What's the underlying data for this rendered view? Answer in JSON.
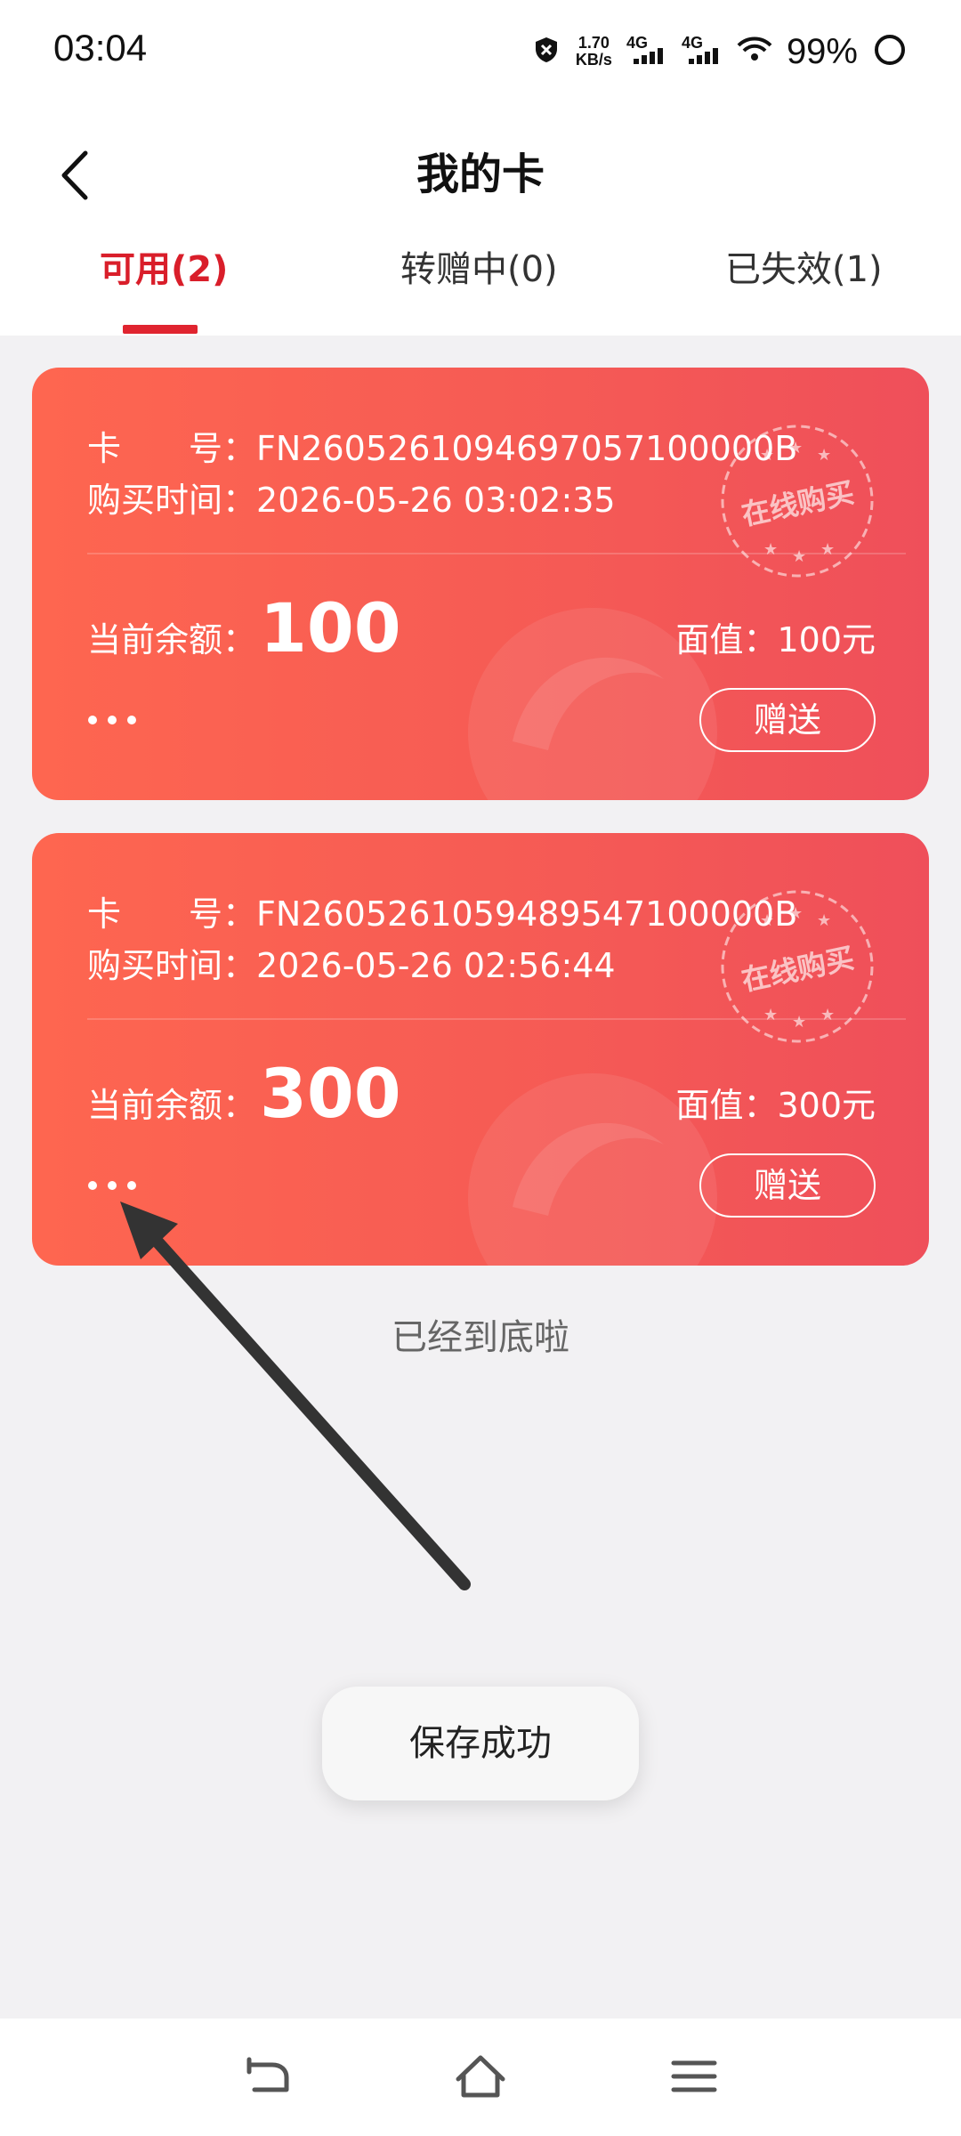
{
  "status_bar": {
    "time": "03:04",
    "net_speed_value": "1.70",
    "net_speed_unit": "KB/s",
    "sim1": "4G",
    "sim2": "4G",
    "battery": "99%"
  },
  "header": {
    "title": "我的卡"
  },
  "tabs": [
    {
      "label": "可用(2)",
      "active": true
    },
    {
      "label": "转赠中(0)",
      "active": false
    },
    {
      "label": "已失效(1)",
      "active": false
    }
  ],
  "cards": [
    {
      "card_no_label_a": "卡",
      "card_no_label_b": "号：",
      "card_no": "FN2605261094697057100000B",
      "purchase_label": "购买时间：",
      "purchase_time": "2026-05-26 03:02:35",
      "balance_label": "当前余额：",
      "balance": "100",
      "face_value": "面值：100元",
      "stamp_text": "在线购买",
      "gift_label": "赠送"
    },
    {
      "card_no_label_a": "卡",
      "card_no_label_b": "号：",
      "card_no": "FN2605261059489547100000B",
      "purchase_label": "购买时间：",
      "purchase_time": "2026-05-26 02:56:44",
      "balance_label": "当前余额：",
      "balance": "300",
      "face_value": "面值：300元",
      "stamp_text": "在线购买",
      "gift_label": "赠送"
    }
  ],
  "list_end_text": "已经到底啦",
  "toast": "保存成功",
  "colors": {
    "accent": "#e0242f",
    "card_start": "#fe6650",
    "card_end": "#ef4f5a",
    "background": "#f2f1f3"
  },
  "icons": {
    "back": "chevron-left-icon",
    "more": "more-dots-icon",
    "nav_back": "nav-back-icon",
    "nav_home": "home-icon",
    "nav_menu": "menu-icon"
  }
}
